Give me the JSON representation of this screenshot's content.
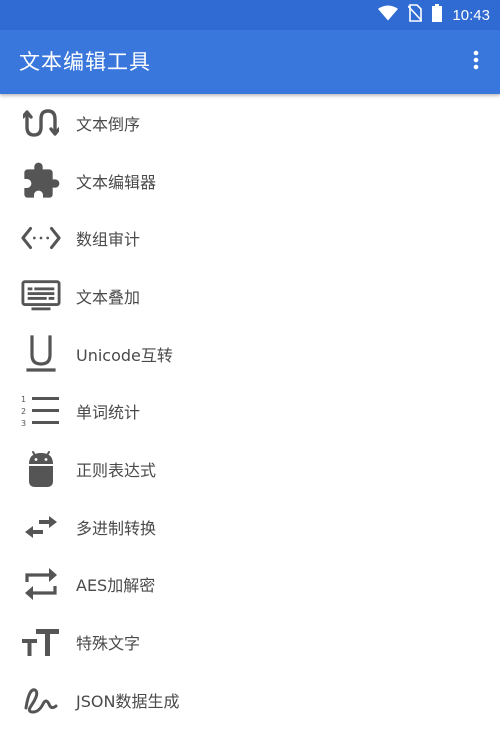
{
  "status_bar": {
    "time": "10:43"
  },
  "app_bar": {
    "title": "文本编辑工具"
  },
  "menu": {
    "items": [
      {
        "label": "文本倒序",
        "icon": "swap-vertical-icon"
      },
      {
        "label": "文本编辑器",
        "icon": "puzzle-piece-icon"
      },
      {
        "label": "数组审计",
        "icon": "settings-ethernet-icon"
      },
      {
        "label": "文本叠加",
        "icon": "subtitles-icon"
      },
      {
        "label": "Unicode互转",
        "icon": "underline-icon"
      },
      {
        "label": "单词统计",
        "icon": "numbered-list-icon"
      },
      {
        "label": "正则表达式",
        "icon": "android-icon"
      },
      {
        "label": "多进制转换",
        "icon": "swap-horizontal-icon"
      },
      {
        "label": "AES加解密",
        "icon": "repeat-icon"
      },
      {
        "label": "特殊文字",
        "icon": "text-size-icon"
      },
      {
        "label": "JSON数据生成",
        "icon": "gesture-icon"
      }
    ]
  },
  "colors": {
    "statusbar": "#2f6bd3",
    "appbar": "#3a77dc",
    "icon": "#555555",
    "label": "#4a4a4a"
  }
}
